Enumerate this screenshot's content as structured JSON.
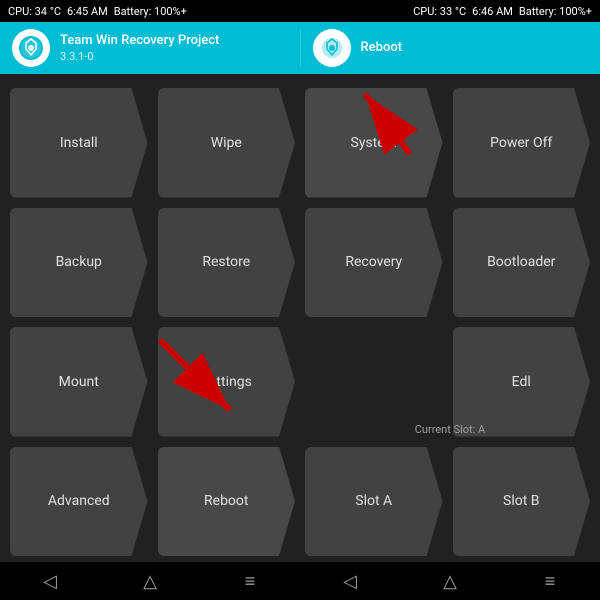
{
  "statusbar": {
    "left": {
      "cpu": "CPU: 34 °C",
      "time": "6:45 AM",
      "battery": "Battery: 100%+"
    },
    "right": {
      "cpu": "CPU: 33 °C",
      "time": "6:46 AM",
      "battery": "Battery: 100%+"
    }
  },
  "header": {
    "left": {
      "title": "Team Win Recovery Project",
      "subtitle": "3.3.1-0"
    },
    "right": {
      "title": "Reboot"
    }
  },
  "buttons": [
    {
      "id": "install",
      "label": "Install"
    },
    {
      "id": "wipe",
      "label": "Wipe"
    },
    {
      "id": "system",
      "label": "System"
    },
    {
      "id": "power-off",
      "label": "Power Off"
    },
    {
      "id": "backup",
      "label": "Backup"
    },
    {
      "id": "restore",
      "label": "Restore"
    },
    {
      "id": "recovery",
      "label": "Recovery"
    },
    {
      "id": "bootloader",
      "label": "Bootloader"
    },
    {
      "id": "mount",
      "label": "Mount"
    },
    {
      "id": "settings",
      "label": "Settings"
    },
    {
      "id": "edl",
      "label": "Edl"
    },
    {
      "id": "advanced",
      "label": "Advanced"
    },
    {
      "id": "reboot",
      "label": "Reboot"
    },
    {
      "id": "slot-a",
      "label": "Slot A"
    },
    {
      "id": "slot-b",
      "label": "Slot B"
    }
  ],
  "current_slot": "Current Slot: A",
  "nav": {
    "icons": [
      "back",
      "home",
      "menu"
    ]
  }
}
